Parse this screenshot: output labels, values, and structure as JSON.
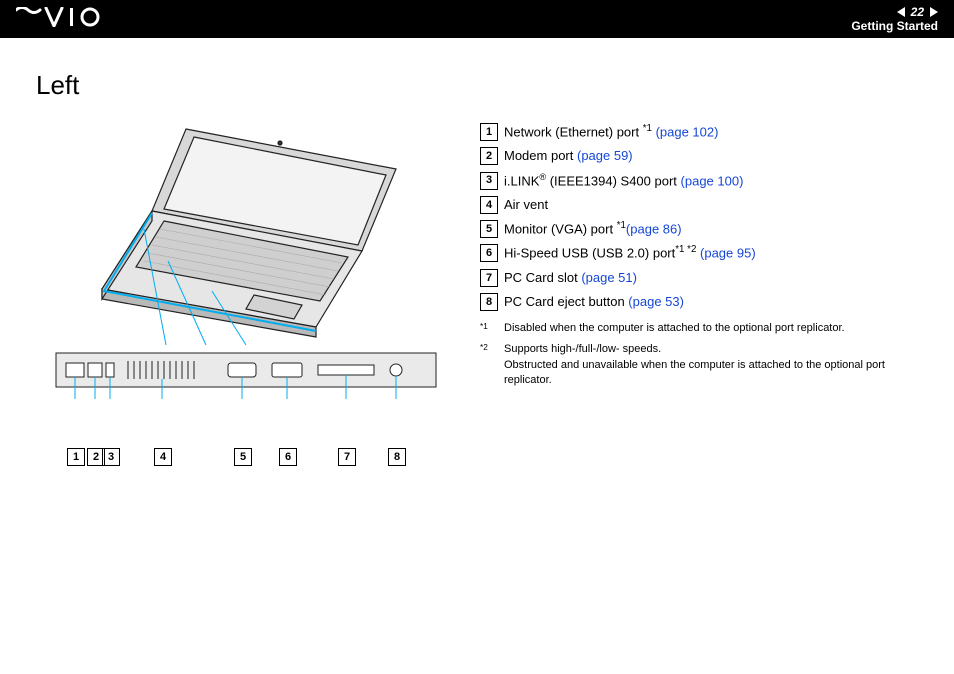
{
  "header": {
    "logo_alt": "VAIO",
    "page_number": "22",
    "section": "Getting Started"
  },
  "title": "Left",
  "items": [
    {
      "n": "1",
      "pre": "Network (Ethernet) port ",
      "sup": "*1",
      "post": " ",
      "link": "(page 102)"
    },
    {
      "n": "2",
      "pre": "Modem port ",
      "sup": "",
      "post": "",
      "link": "(page 59)"
    },
    {
      "n": "3",
      "pre": "i.LINK",
      "reg": "®",
      "mid": " (IEEE1394) S400 port ",
      "sup": "",
      "post": "",
      "link": "(page 100)"
    },
    {
      "n": "4",
      "pre": "Air vent",
      "sup": "",
      "post": "",
      "link": ""
    },
    {
      "n": "5",
      "pre": "Monitor (VGA) port ",
      "sup": "*1",
      "post": "",
      "link": "(page 86)"
    },
    {
      "n": "6",
      "pre": "Hi-Speed USB (USB 2.0) port",
      "sup": "*1 *2",
      "post": " ",
      "link": "(page 95)"
    },
    {
      "n": "7",
      "pre": "PC Card slot ",
      "sup": "",
      "post": "",
      "link": "(page 51)"
    },
    {
      "n": "8",
      "pre": "PC Card eject button ",
      "sup": "",
      "post": "",
      "link": "(page 53)"
    }
  ],
  "footnotes": [
    {
      "mark": "*1",
      "text": "Disabled when the computer is attached to the optional port replicator."
    },
    {
      "mark": "*2",
      "text": "Supports high-/full-/low- speeds.\nObstructed and unavailable when the computer is attached to the optional port replicator."
    }
  ],
  "callouts": [
    "1",
    "2",
    "3",
    "4",
    "5",
    "6",
    "7",
    "8"
  ]
}
